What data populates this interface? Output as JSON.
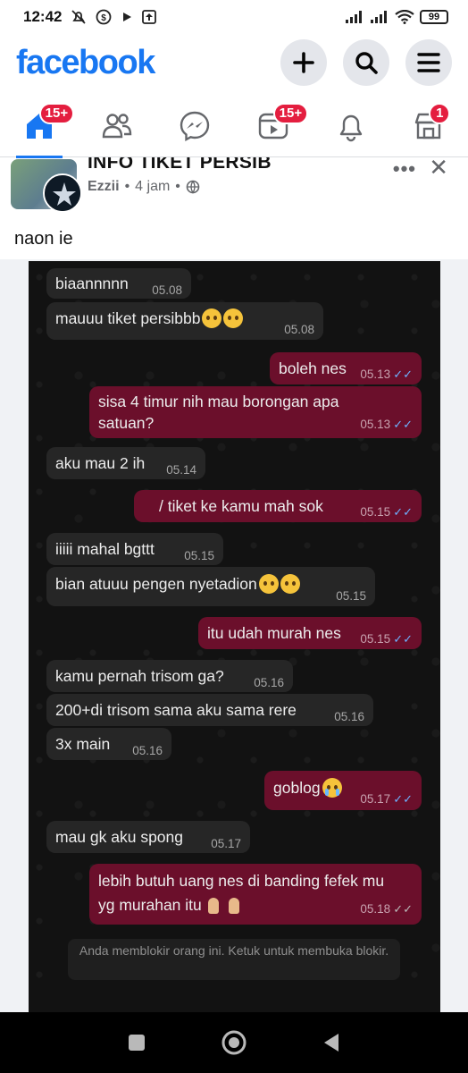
{
  "status_bar": {
    "time": "12:42",
    "battery": "99",
    "icons": [
      "mute-bell-icon",
      "dollar-circle-icon",
      "play-icon",
      "upload-icon",
      "signal-icon",
      "signal-icon",
      "wifi-icon",
      "battery-icon"
    ]
  },
  "header": {
    "logo": "facebook",
    "actions": [
      "plus-icon",
      "search-icon",
      "menu-icon"
    ],
    "brand_color": "#1877f2"
  },
  "nav": [
    {
      "icon": "home-icon",
      "badge": "15+",
      "active": true
    },
    {
      "icon": "friends-icon",
      "badge": ""
    },
    {
      "icon": "messenger-icon",
      "badge": ""
    },
    {
      "icon": "video-icon",
      "badge": "15+"
    },
    {
      "icon": "bell-icon",
      "badge": ""
    },
    {
      "icon": "marketplace-icon",
      "badge": "1"
    }
  ],
  "post": {
    "group_name": "INFO TIKET PERSIB",
    "author": "Ezzii",
    "time": "4 jam",
    "caption": "naon ie"
  },
  "chat": {
    "messages": [
      {
        "dir": "in",
        "text": "biaannnnn",
        "time": "05.08"
      },
      {
        "dir": "in",
        "text": "mauuu tiket persibbb",
        "time": "05.08"
      },
      {
        "dir": "out",
        "text": "boleh nes",
        "time": "05.13"
      },
      {
        "dir": "out",
        "text": "sisa 4 timur nih mau borongan apa",
        "text2": "satuan?",
        "time": "05.13"
      },
      {
        "dir": "in",
        "text": "aku mau 2 ih",
        "time": "05.14"
      },
      {
        "dir": "out",
        "text": "/ tiket ke kamu mah sok",
        "time": "05.15"
      },
      {
        "dir": "in",
        "text": "iiiii mahal bgttt",
        "time": "05.15"
      },
      {
        "dir": "in",
        "text": "bian atuuu pengen nyetadion",
        "time": "05.15"
      },
      {
        "dir": "out",
        "text": "itu udah murah nes",
        "time": "05.15"
      },
      {
        "dir": "in",
        "text": "kamu pernah trisom ga?",
        "time": "05.16"
      },
      {
        "dir": "in",
        "text": "200+di trisom sama aku sama rere",
        "time": "05.16"
      },
      {
        "dir": "in",
        "text": "3x main",
        "time": "05.16"
      },
      {
        "dir": "out",
        "text": "goblog",
        "time": "05.17"
      },
      {
        "dir": "in",
        "text": "mau gk aku spong",
        "time": "05.17"
      },
      {
        "dir": "out",
        "text": "lebih butuh uang nes di banding fefek mu",
        "text2": "yg murahan itu",
        "time": "05.18"
      }
    ],
    "system_note": "Anda memblokir orang ini. Ketuk untuk membuka blokir."
  },
  "android_nav": [
    "square-icon",
    "home-circle-icon",
    "back-triangle-icon"
  ]
}
